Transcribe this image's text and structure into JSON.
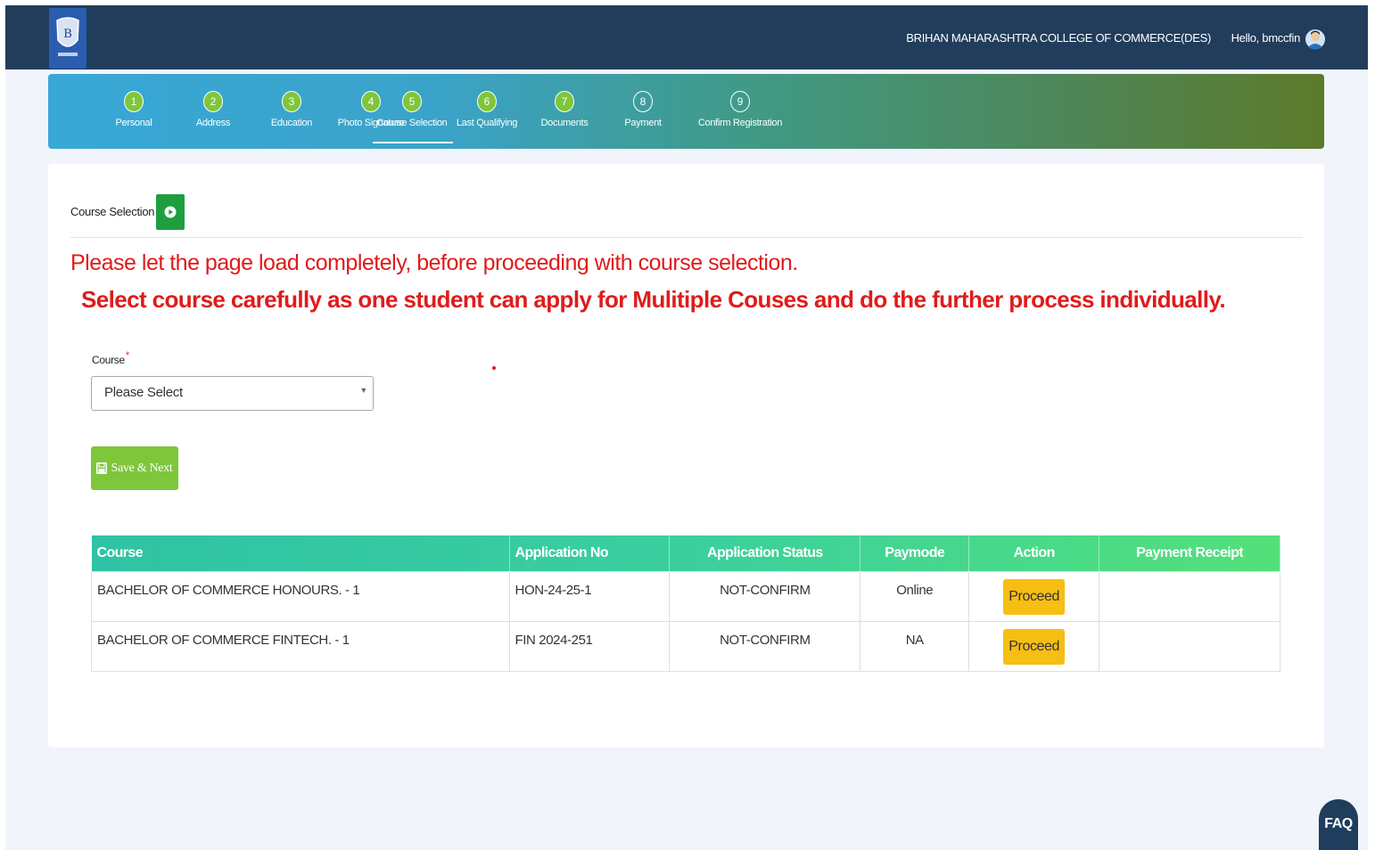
{
  "header": {
    "college_name": "BRIHAN MAHARASHTRA COLLEGE OF COMMERCE(DES)",
    "greeting": "Hello, bmccfin",
    "logo_icon": "college-crest-icon",
    "avatar_icon": "user-avatar-icon",
    "bg_color": "#213d5b"
  },
  "wizard": {
    "active_index": 4,
    "steps": [
      {
        "num": "1",
        "label": "Personal"
      },
      {
        "num": "2",
        "label": "Address"
      },
      {
        "num": "3",
        "label": "Education"
      },
      {
        "num": "4",
        "label": "Photo Signature"
      },
      {
        "num": "5",
        "label": "Course Selection"
      },
      {
        "num": "6",
        "label": "Last Qualifying"
      },
      {
        "num": "7",
        "label": "Documents"
      },
      {
        "num": "8",
        "label": "Payment"
      },
      {
        "num": "9",
        "label": "Confirm Registration"
      }
    ]
  },
  "main": {
    "title": "Course Selection",
    "notice_line1": "Please let the page load completely, before proceeding with course selection.",
    "notice_line2": "Select course carefully as one student can apply for Mulitiple Couses and do the further process individually.",
    "course_field": {
      "label": "Course",
      "required_mark": "*",
      "selected": "Please Select"
    },
    "save_button": "Save & Next",
    "save_icon": "floppy-disk-icon"
  },
  "table": {
    "headers": [
      "Course",
      "Application No",
      "Application Status",
      "Paymode",
      "Action",
      "Payment Receipt"
    ],
    "rows": [
      {
        "course": "BACHELOR OF COMMERCE HONOURS. - 1",
        "app_no": "HON-24-25-1",
        "status": "NOT-CONFIRM",
        "paymode": "Online",
        "action": "Proceed",
        "receipt": ""
      },
      {
        "course": "BACHELOR OF COMMERCE FINTECH. - 1",
        "app_no": "FIN 2024-251",
        "status": "NOT-CONFIRM",
        "paymode": "NA",
        "action": "Proceed",
        "receipt": ""
      }
    ]
  },
  "faq": {
    "label": "FAQ"
  },
  "colors": {
    "accent_red": "#e01b1b",
    "step_done": "#7ec63a",
    "proceed": "#f7be13",
    "save": "#7ec63a"
  }
}
